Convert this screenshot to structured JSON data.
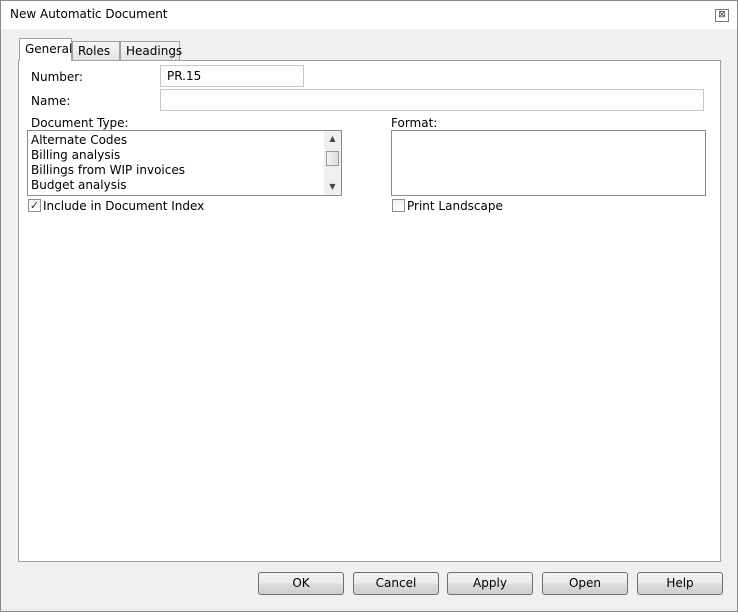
{
  "window": {
    "title": "New Automatic Document",
    "close_glyph": "⊠"
  },
  "tabs": [
    {
      "label": "General",
      "active": true
    },
    {
      "label": "Roles",
      "active": false
    },
    {
      "label": "Headings",
      "active": false
    }
  ],
  "general": {
    "number_label": "Number:",
    "number_value": "PR.15",
    "name_label": "Name:",
    "name_value": "",
    "doc_type_label": "Document Type:",
    "doc_types": [
      "Alternate Codes",
      "Billing analysis",
      "Billings from WIP invoices",
      "Budget analysis"
    ],
    "format_label": "Format:",
    "include_index_label": "Include in Document Index",
    "include_index_checked": true,
    "print_landscape_label": "Print Landscape",
    "print_landscape_checked": false
  },
  "buttons": {
    "ok": "OK",
    "cancel": "Cancel",
    "apply": "Apply",
    "open": "Open",
    "help": "Help"
  },
  "glyphs": {
    "check": "✓",
    "scroll_up": "▲",
    "scroll_down": "▼"
  }
}
